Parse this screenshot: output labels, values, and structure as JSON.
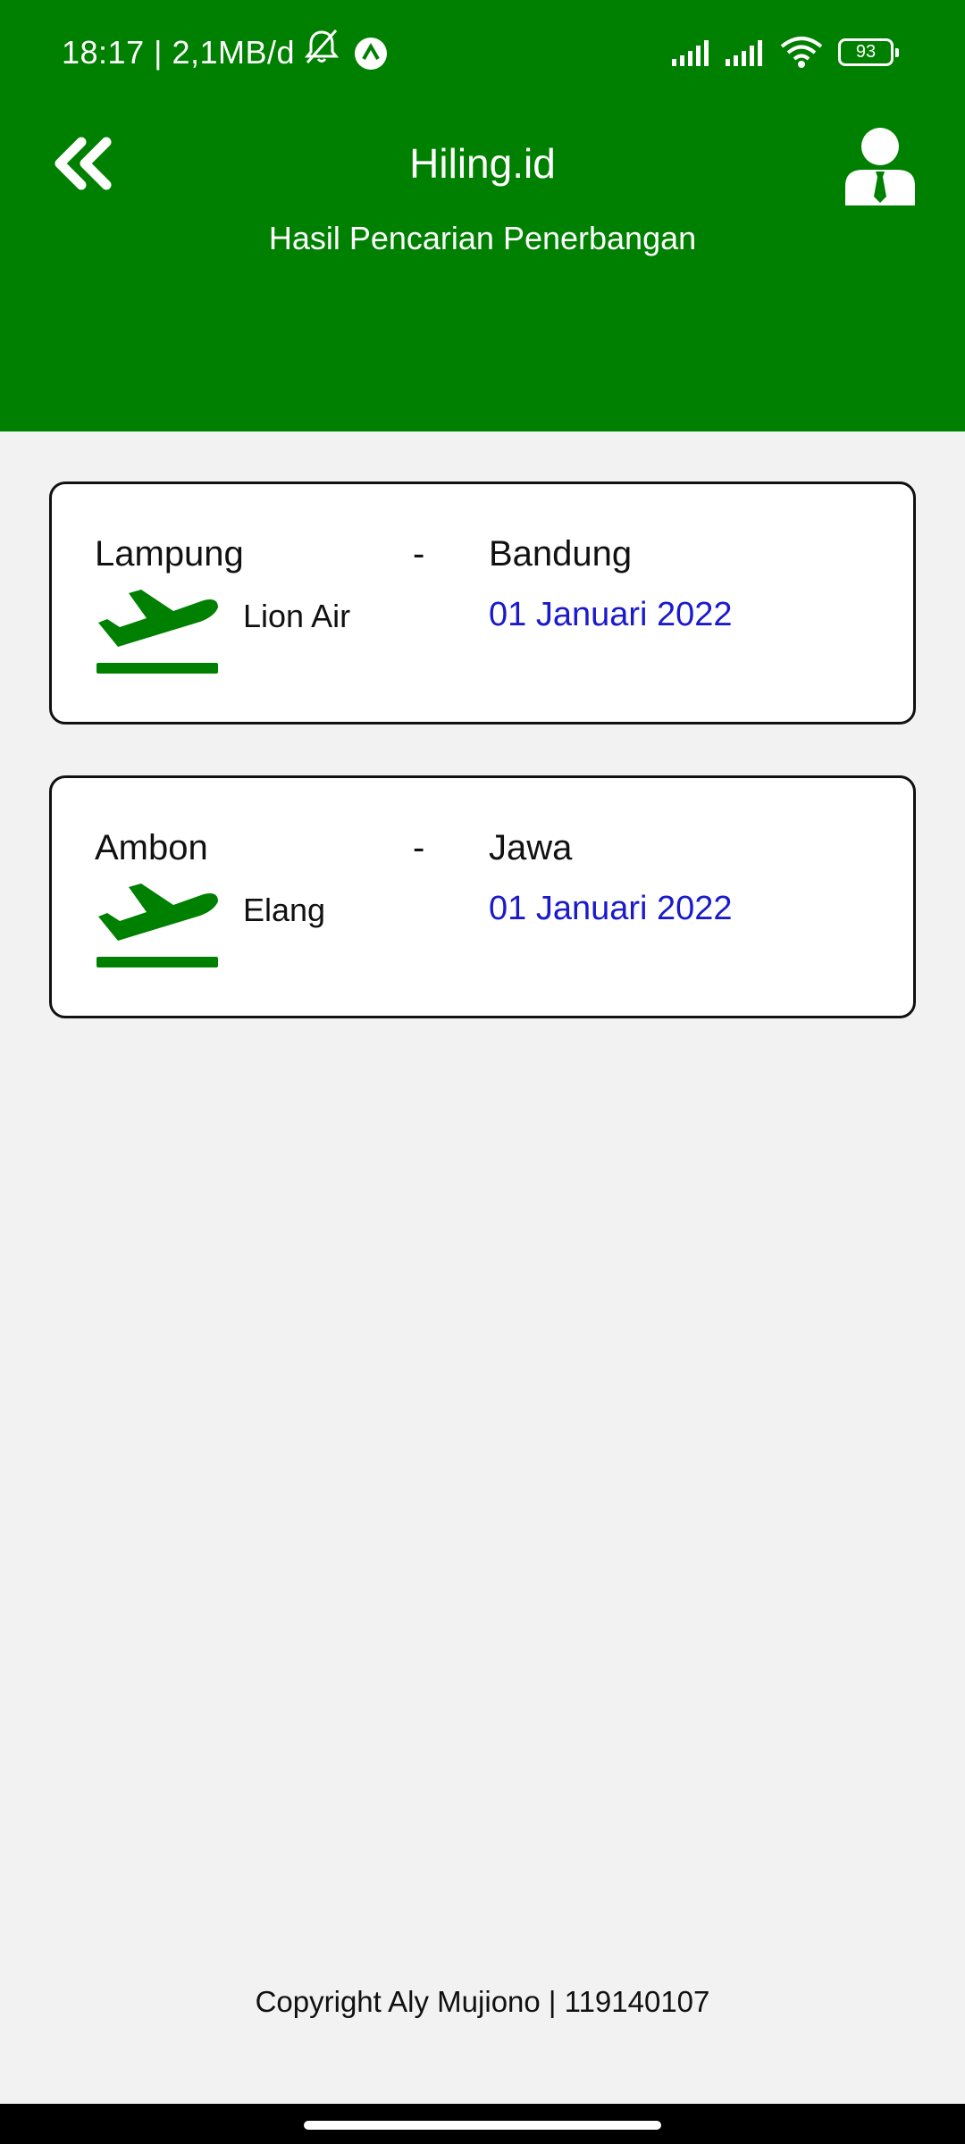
{
  "status_bar": {
    "left_text": "18:17 | 2,1MB/d",
    "battery": "93",
    "icons": [
      "bell-muted-icon",
      "app-notification-icon",
      "signal-icon",
      "signal-icon",
      "wifi-icon",
      "battery-icon"
    ]
  },
  "header": {
    "title": "Hiling.id",
    "subtitle": "Hasil Pencarian Penerbangan",
    "back_icon": "double-chevron-left-icon",
    "profile_icon": "user-profile-icon",
    "background_color": "#008000"
  },
  "flights": [
    {
      "origin": "Lampung",
      "separator": "-",
      "destination": "Bandung",
      "airline": "Lion Air",
      "date": "01 Januari 2022",
      "icon": "plane-departure-icon"
    },
    {
      "origin": "Ambon",
      "separator": "-",
      "destination": "Jawa",
      "airline": "Elang",
      "date": "01 Januari 2022",
      "icon": "plane-departure-icon"
    }
  ],
  "footer": {
    "text": "Copyright Aly Mujiono | 119140107"
  },
  "colors": {
    "accent": "#008000",
    "date_text": "#1a1acc",
    "background": "#f2f2f2"
  }
}
